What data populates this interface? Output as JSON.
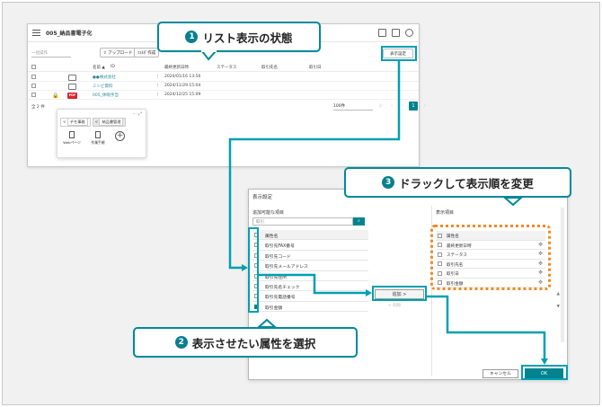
{
  "window": {
    "title": "005_納品書電子化",
    "toolbar": {
      "select_placeholder": "一括操作",
      "upload": "アップロード",
      "folder": "ﾌｫﾙﾀﾞ作成",
      "display_settings": "表示設定"
    },
    "columns": [
      "名前 ▲",
      "ID",
      "最終更新日時",
      "ステータス",
      "取引先名",
      "取引日"
    ],
    "rows": [
      {
        "name": "●●株式会社",
        "date": "2020/01/16 13:56",
        "type": "folder"
      },
      {
        "name": "ミシビ資料",
        "date": "2024/11/29 15:04",
        "type": "folder"
      },
      {
        "name": "005_休暇手当",
        "date": "2024/12/25 15:09",
        "type": "pdf"
      }
    ],
    "count": "全 2 件",
    "per_page": "100件",
    "current_page": "1",
    "panel": {
      "tabs": [
        "デモ事務",
        "納品書管理"
      ],
      "items": [
        "Webページ",
        "作業手順"
      ]
    }
  },
  "dialog": {
    "title": "表示設定",
    "left_header": "追加可能な項目",
    "search_placeholder": "取引",
    "attr_header": "属性名",
    "left_items": [
      {
        "label": "取引先FAX番号",
        "checked": false
      },
      {
        "label": "取引先コード",
        "checked": false
      },
      {
        "label": "取引先メールアドレス",
        "checked": false
      },
      {
        "label": "取引先住所",
        "checked": false
      },
      {
        "label": "取引先名チェック",
        "checked": false
      },
      {
        "label": "取引先電話番号",
        "checked": false
      },
      {
        "label": "取引金額",
        "checked": true
      }
    ],
    "add_button": "追加 >",
    "remove_button": "< 削除",
    "right_header": "表示項目",
    "right_items": [
      "最終更新日時",
      "ステータス",
      "取引先名",
      "取引日",
      "取引金額"
    ],
    "cancel": "キャンセル",
    "ok": "OK"
  },
  "callouts": {
    "c1": {
      "num": "1",
      "text": "リスト表示の状態"
    },
    "c2": {
      "num": "2",
      "text": "表示させたい属性を選択"
    },
    "c3": {
      "num": "3",
      "text": "ドラックして表示順を変更"
    }
  },
  "colors": {
    "accent": "#008a99",
    "highlight": "#00a0b0",
    "dashed": "#f08a24",
    "pdf": "#d9242b"
  }
}
